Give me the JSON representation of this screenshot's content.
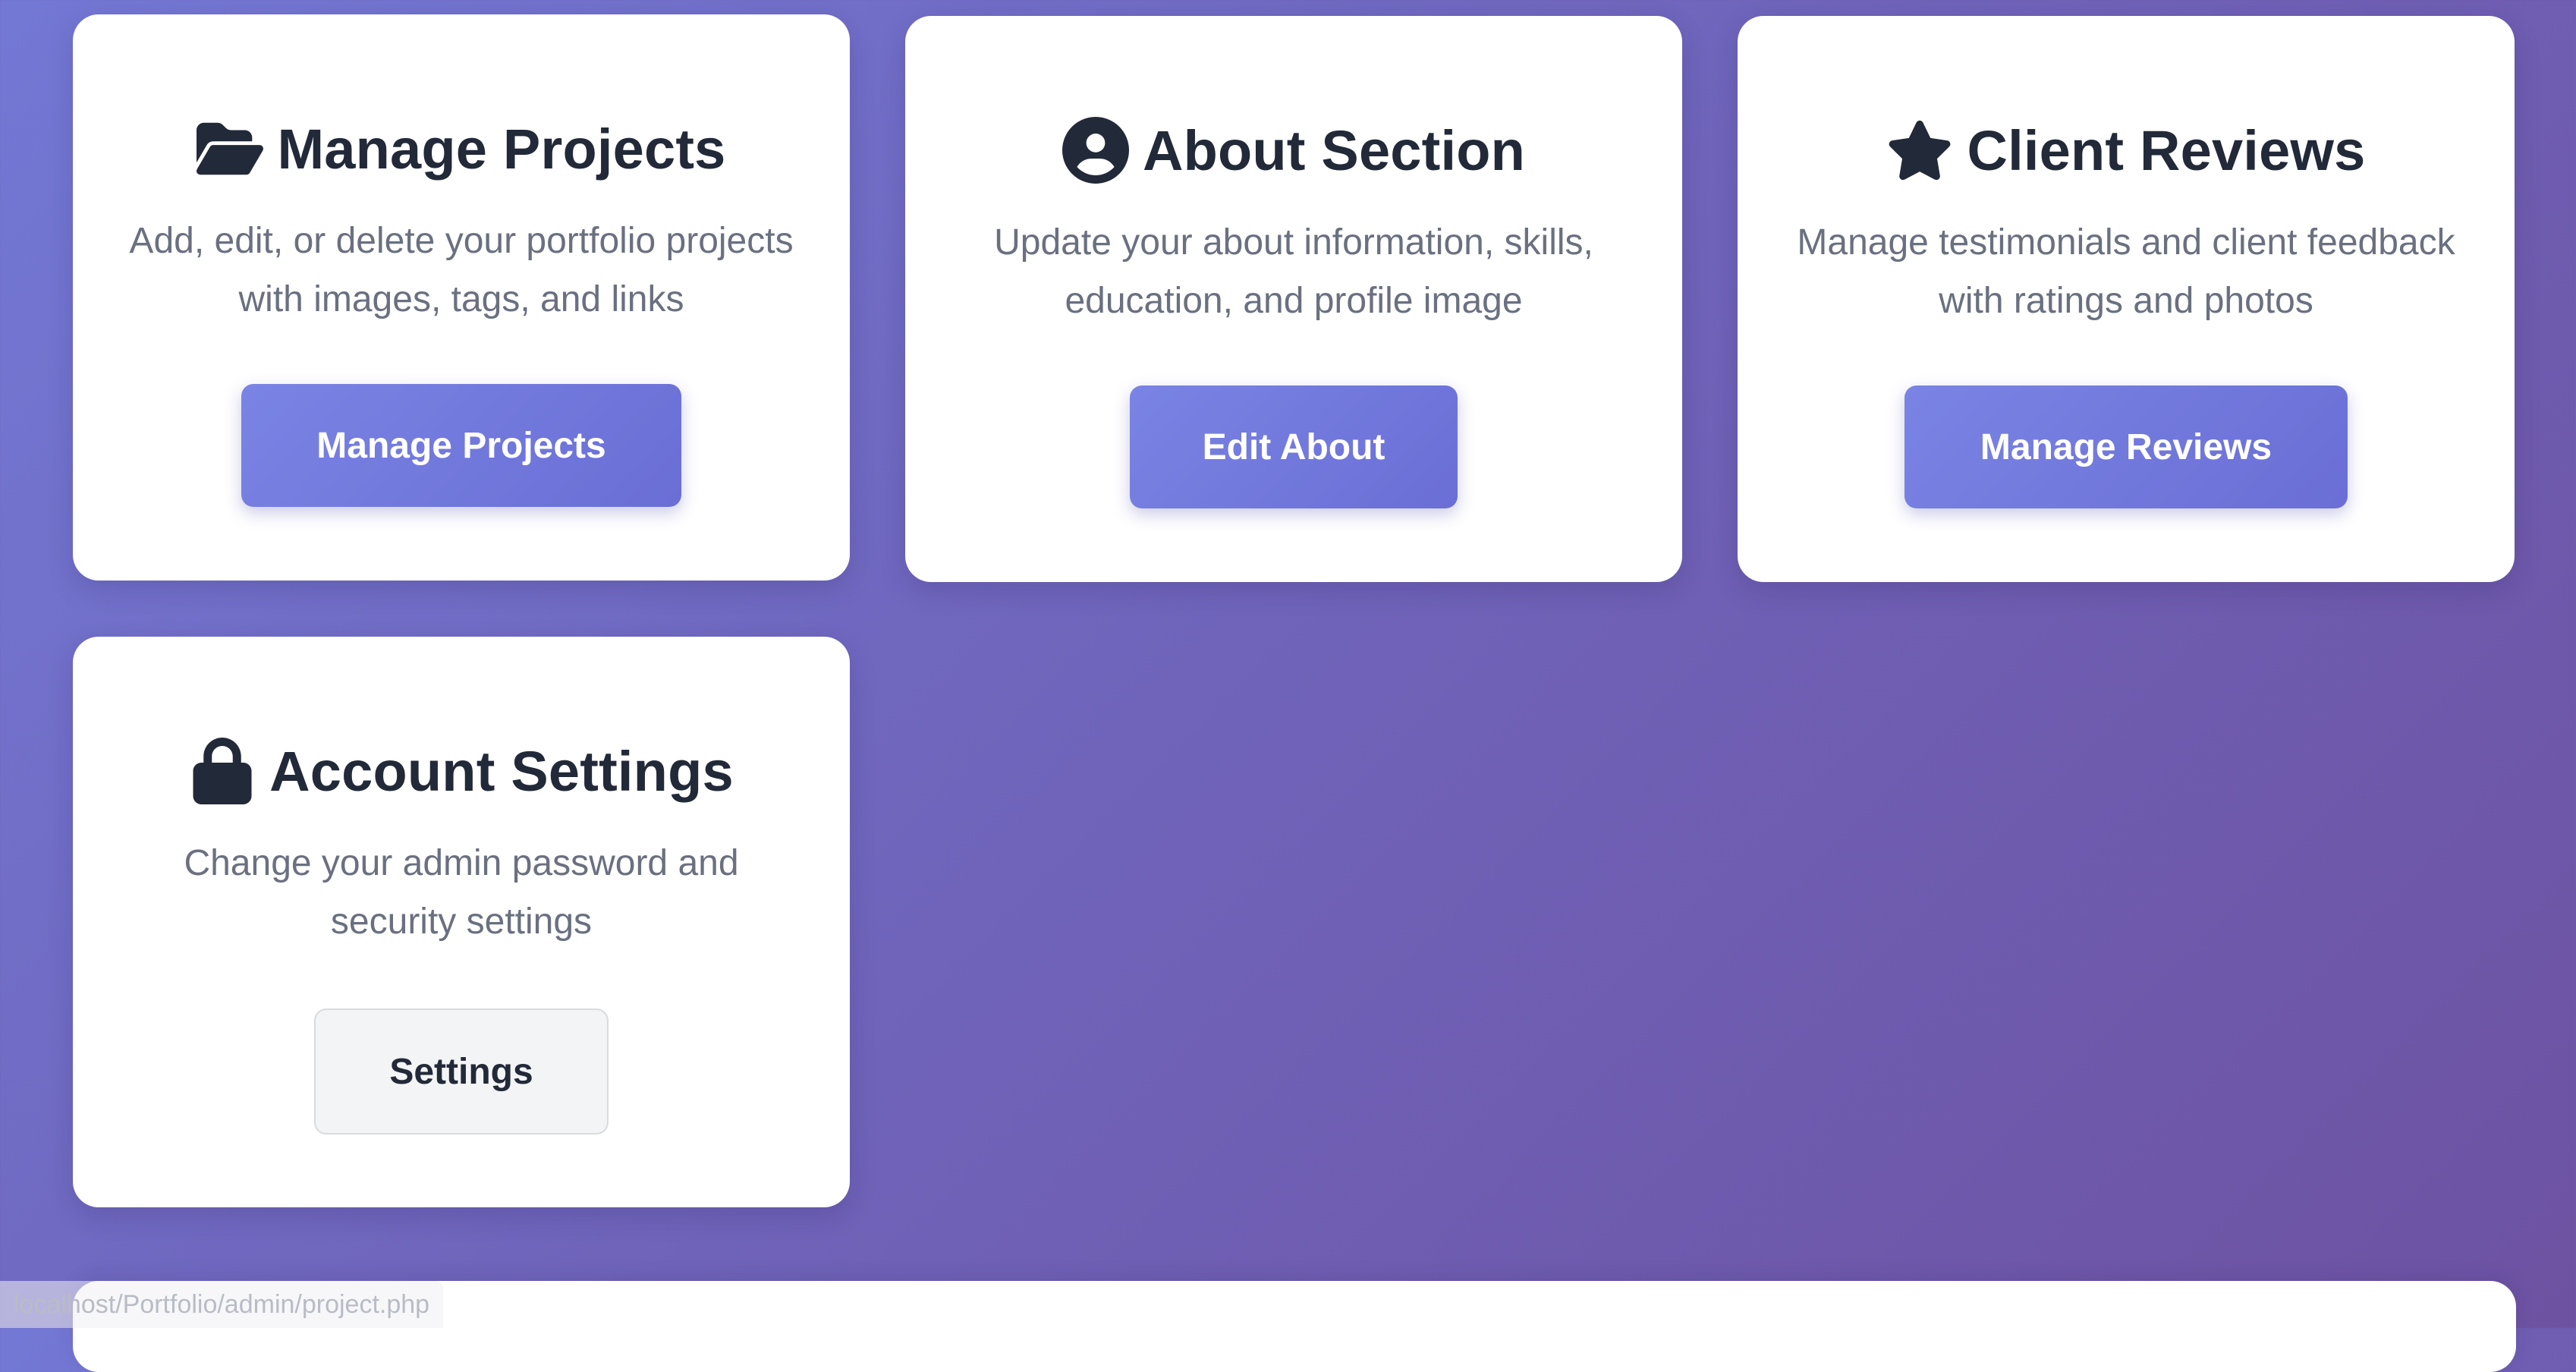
{
  "cards": [
    {
      "title": "Manage Projects",
      "icon": "folder-open-icon",
      "description": "Add, edit, or delete your portfolio projects with images, tags, and links",
      "button_label": "Manage Projects"
    },
    {
      "title": "About Section",
      "icon": "user-circle-icon",
      "description": "Update your about information, skills, education, and profile image",
      "button_label": "Edit About"
    },
    {
      "title": "Client Reviews",
      "icon": "star-icon",
      "description": "Manage testimonials and client feedback with ratings and photos",
      "button_label": "Manage Reviews"
    },
    {
      "title": "Account Settings",
      "icon": "lock-icon",
      "description": "Change your admin password and security settings",
      "button_label": "Settings"
    }
  ],
  "status_bar": {
    "url": "localhost/Portfolio/admin/project.php"
  },
  "colors": {
    "background_start": "#7378d4",
    "background_end": "#6e52a2",
    "button_primary": "#6a6ed5",
    "button_secondary": "#f3f4f6",
    "title_text": "#222938",
    "body_text": "#6a7080"
  }
}
